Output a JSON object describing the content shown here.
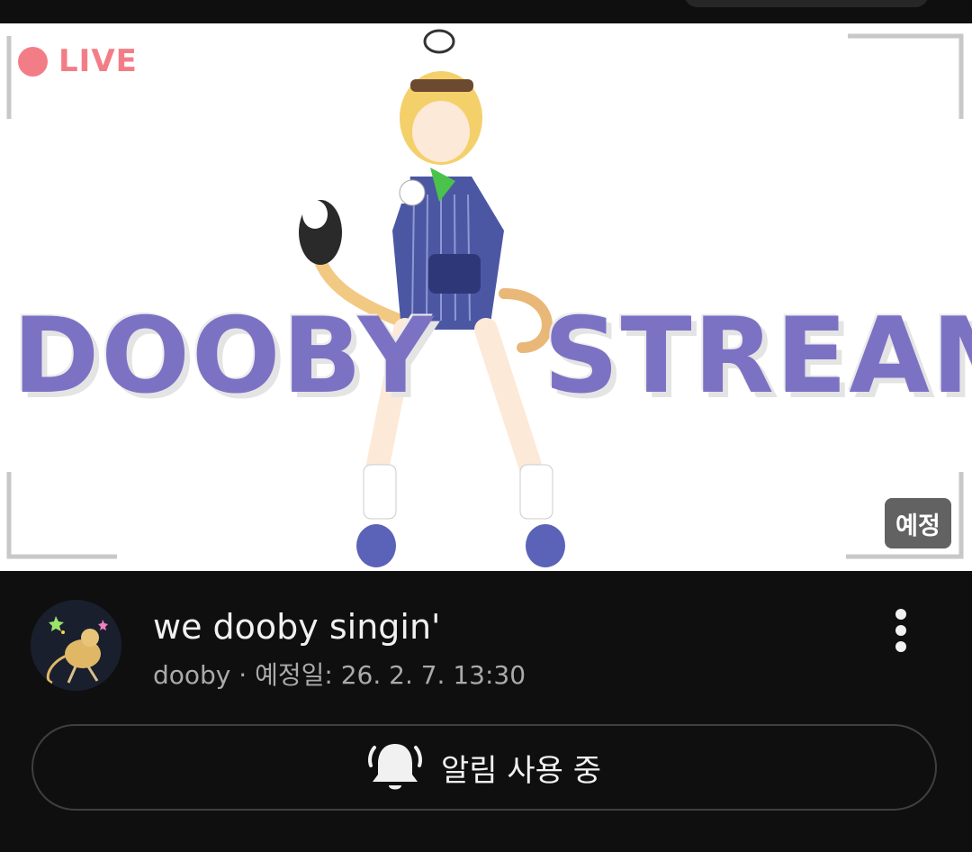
{
  "thumbnail": {
    "live_label": "LIVE",
    "banner_left": "DOOBY",
    "banner_right": "STREAM",
    "scheduled_badge": "예정",
    "colors": {
      "live": "#f37d86",
      "banner": "#7c72c4"
    }
  },
  "video": {
    "title": "we dooby singin'",
    "meta": "dooby · 예정일: 26. 2. 7. 13:30",
    "channel_avatar_icon": "kangaroo-rat-avatar",
    "more_icon": "more-vertical-icon"
  },
  "notify": {
    "label": "알림 사용 중",
    "icon": "bell-icon"
  }
}
